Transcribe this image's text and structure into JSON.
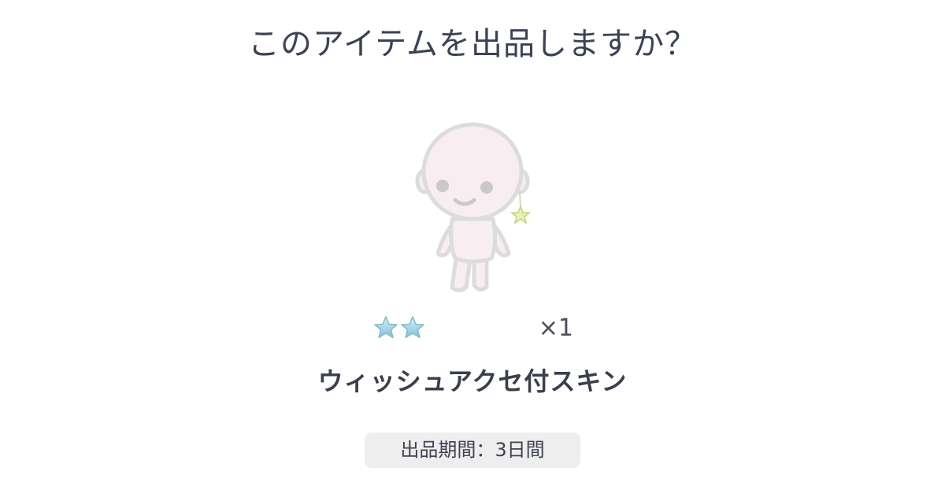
{
  "dialog": {
    "title": "このアイテムを出品しますか？",
    "item": {
      "icon": "avatar-skin-with-star-earring",
      "rarity_stars": 2,
      "quantity": "×1",
      "name": "ウィッシュアクセ付スキン"
    },
    "listing_period": "出品期間：3日間"
  },
  "colors": {
    "title_text": "#3c4254",
    "star_fill": "#9fd6e6",
    "badge_bg": "#eeeeee",
    "avatar_skin": "#f8eef1",
    "avatar_outline": "#dcdcdc"
  }
}
